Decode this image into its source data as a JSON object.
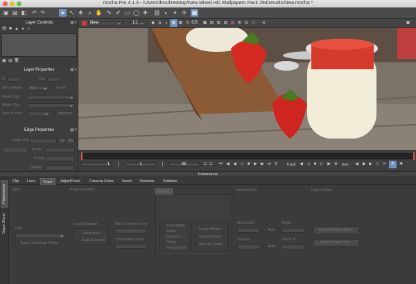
{
  "window": {
    "title": "mocha Pro 4.1.3 - /Users/dmx/Desktop/New Mixed HD Wallpapers Pack 294/results/New.mocha *"
  },
  "viewer": {
    "clip": "New",
    "zoom": "1:1",
    "opacity": "0.5",
    "image_desc": "strawberries"
  },
  "layer_controls": {
    "title": "Layer Controls"
  },
  "layer_properties": {
    "title": "Layer Properties",
    "in": "In",
    "out": "Out",
    "blend_mode": "Blend Mode",
    "blend_value": "Add",
    "invert": "Invert",
    "insert_clip": "Insert Clip",
    "matte_clip": "Matte Clip",
    "link_to_track": "Link to track",
    "adjusted": "Adjusted"
  },
  "edge_properties": {
    "title": "Edge Properties",
    "edge_width": "Edge Width",
    "set": "Set",
    "all": "All",
    "angle": "Angle",
    "phase": "Phase",
    "quality": "Quality"
  },
  "timeline": {
    "start": "1",
    "current": "1",
    "end": "66",
    "track": "Track",
    "key": "Key"
  },
  "parameters": {
    "title": "Parameters",
    "tabs": [
      "Clip",
      "Lens",
      "Track",
      "AdjustTrack",
      "Camera Solve",
      "Insert",
      "Remove",
      "Stabilize"
    ],
    "side_tabs": [
      "Parameters",
      "Dope Sheet"
    ],
    "input": {
      "title": "Input",
      "clip": "Clip",
      "track_individual": "Track Individual Fields"
    },
    "preprocessing": {
      "title": "Preprocessing",
      "input_channel": "Input Channel",
      "luminance": "Luminance",
      "auto_channel": "Auto Channel",
      "min_pixels": "Min % Pixels Used",
      "smoothing": "Smoothing Level"
    },
    "motion": {
      "title": "Motion",
      "translation": "Translation",
      "scale": "Scale",
      "rotation": "Rotation",
      "shear": "Shear",
      "perspective": "Perspective",
      "large": "Large Motion",
      "small": "Small Motion",
      "manual": "Manual Track"
    },
    "search_area": {
      "title": "Search Area",
      "horizontal": "Horizontal",
      "vertical": "Vertical",
      "auto": "Auto",
      "angle": "Angle",
      "zoom": "Zoom %"
    },
    "export": {
      "title": "Export Data",
      "tracking": "Export Tracking Data...",
      "shape": "Export Shape Data..."
    }
  }
}
